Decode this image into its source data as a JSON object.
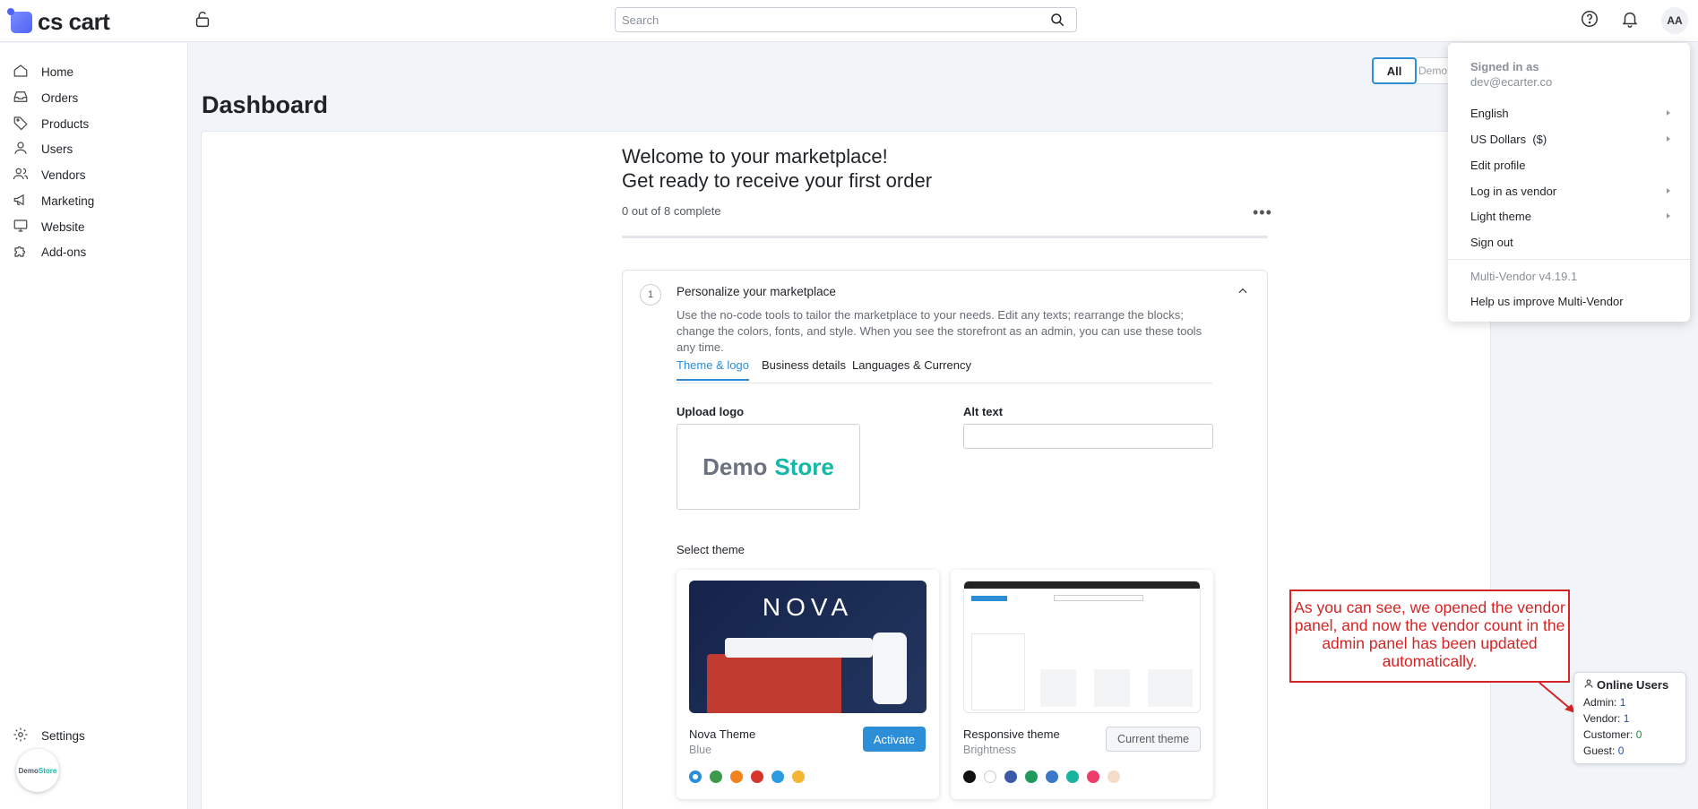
{
  "app": {
    "logo_text": "cs cart"
  },
  "header": {
    "search_placeholder": "Search",
    "avatar_initials": "AA"
  },
  "sidebar": {
    "items": [
      {
        "label": "Home",
        "icon": "home-icon"
      },
      {
        "label": "Orders",
        "icon": "inbox-icon"
      },
      {
        "label": "Products",
        "icon": "tag-icon"
      },
      {
        "label": "Users",
        "icon": "user-icon"
      },
      {
        "label": "Vendors",
        "icon": "users-icon"
      },
      {
        "label": "Marketing",
        "icon": "megaphone-icon"
      },
      {
        "label": "Website",
        "icon": "monitor-icon"
      },
      {
        "label": "Add-ons",
        "icon": "puzzle-icon"
      }
    ],
    "settings_label": "Settings",
    "store_badge": {
      "part1": "Demo",
      "part2": "Store"
    }
  },
  "main": {
    "page_title": "Dashboard",
    "store_tabs": {
      "all": "All",
      "demo": "Demo Store"
    },
    "welcome_line1": "Welcome to your marketplace!",
    "welcome_line2": "Get ready to receive your first order",
    "progress_text": "0 out of 8 complete",
    "progress_fraction": 0,
    "more_label": "•••",
    "step": {
      "number": "1",
      "title": "Personalize your marketplace",
      "description": "Use the no-code tools to tailor the marketplace to your needs. Edit any texts; rearrange the blocks; change the colors, fonts, and style. When you see the storefront as an admin, you can use these tools any time.",
      "tabs": [
        "Theme & logo",
        "Business details",
        "Languages & Currency"
      ],
      "active_tab": 0,
      "upload_logo_label": "Upload logo",
      "logo_preview": {
        "part1": "Demo",
        "part2": "Store"
      },
      "alt_text_label": "Alt text",
      "alt_text_value": "",
      "select_theme_label": "Select theme",
      "themes": [
        {
          "name": "Nova Theme",
          "style": "Blue",
          "button": "Activate",
          "thumb_title": "NOVA",
          "swatches": [
            "#2d8ed8",
            "#3a9a4a",
            "#f0831e",
            "#d7342c",
            "#2a9be0",
            "#f2b632"
          ]
        },
        {
          "name": "Responsive theme",
          "style": "Brightness",
          "button": "Current theme",
          "swatches": [
            "#111111",
            "#ffffff",
            "#3a5aa8",
            "#1f9a5c",
            "#3b78c8",
            "#19b3a0",
            "#f03c6a",
            "#f6dcc6"
          ]
        }
      ]
    }
  },
  "dropdown": {
    "signed_in_label": "Signed in as",
    "email": "dev@ecarter.co",
    "items": [
      "English",
      "US Dollars  ($)",
      "Edit profile",
      "Log in as vendor",
      "Light theme",
      "Sign out"
    ],
    "version": "Multi-Vendor v4.19.1",
    "help": "Help us improve Multi-Vendor"
  },
  "annotation": {
    "text": "As you can see, we opened the vendor panel, and now the vendor count in the admin panel has been updated automatically.",
    "color": "#d32525"
  },
  "online_users": {
    "title": "Online Users",
    "rows": [
      {
        "label": "Admin:",
        "value": "1"
      },
      {
        "label": "Vendor:",
        "value": "1"
      },
      {
        "label": "Customer:",
        "value": "0"
      },
      {
        "label": "Guest:",
        "value": "0"
      }
    ]
  }
}
